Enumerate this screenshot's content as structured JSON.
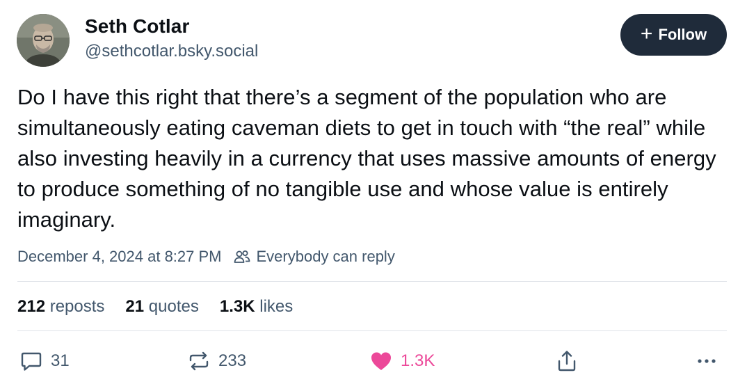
{
  "author": {
    "name": "Seth Cotlar",
    "handle": "@sethcotlar.bsky.social"
  },
  "follow_button": {
    "icon": "+",
    "label": "Follow"
  },
  "post": {
    "text": "Do I have this right that there’s a segment of the population who are simultaneously eating caveman diets to get in touch with “the real” while also investing heavily in a currency that uses massive amounts of energy to produce something of no tangible use and whose value is entirely imaginary.",
    "timestamp": "December 4, 2024 at 8:27 PM",
    "reply_setting": "Everybody can reply"
  },
  "stats": {
    "reposts": {
      "count": "212",
      "label": "reposts"
    },
    "quotes": {
      "count": "21",
      "label": "quotes"
    },
    "likes": {
      "count": "1.3K",
      "label": "likes"
    }
  },
  "actions": {
    "reply_count": "31",
    "repost_count": "233",
    "like_count": "1.3K",
    "like_color": "#ec4899",
    "icons": [
      "speech-bubble-icon",
      "repost-icon",
      "heart-icon",
      "share-icon",
      "more-icon"
    ]
  },
  "colors": {
    "text": "#0b0f14",
    "muted": "#42576c",
    "follow_bg": "#1f2b3a",
    "divider": "#dfe3e8"
  }
}
